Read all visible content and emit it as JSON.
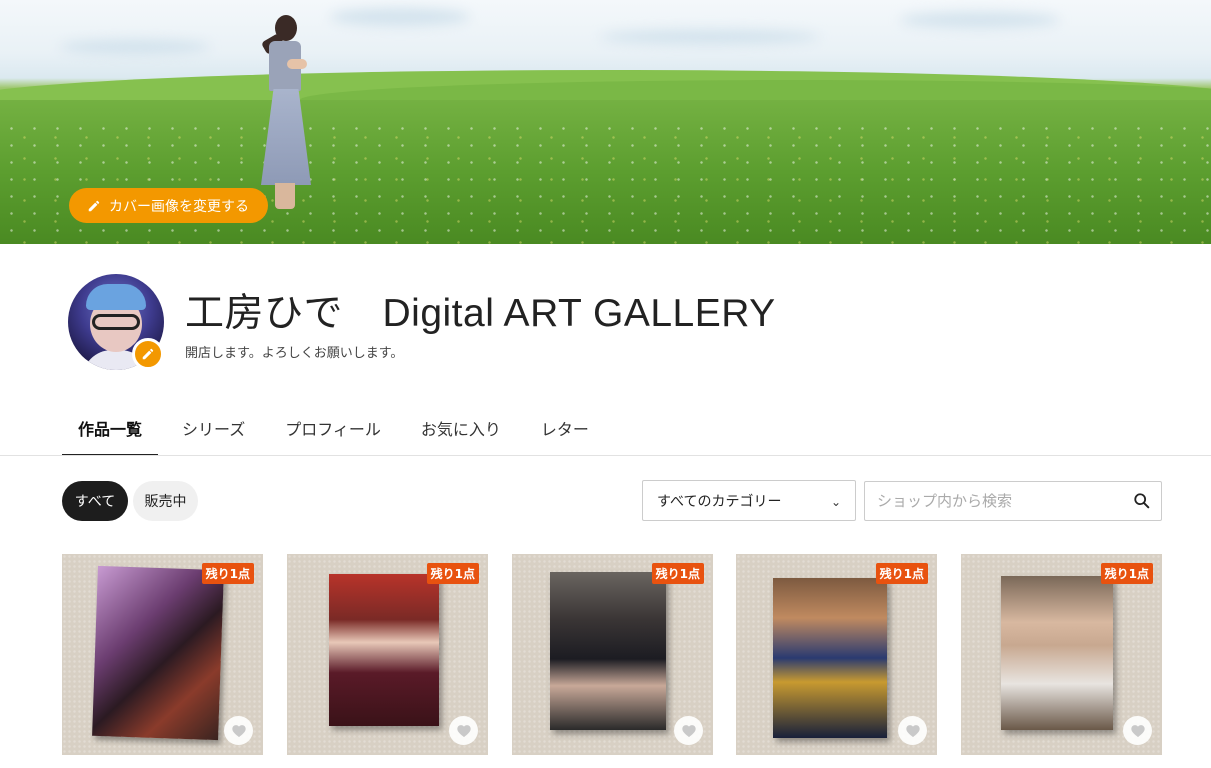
{
  "cover": {
    "change_button_label": "カバー画像を変更する"
  },
  "profile": {
    "shop_name": "工房ひで　Digital ART GALLERY",
    "description": "開店します。よろしくお願いします。"
  },
  "tabs": [
    {
      "label": "作品一覧",
      "active": true
    },
    {
      "label": "シリーズ",
      "active": false
    },
    {
      "label": "プロフィール",
      "active": false
    },
    {
      "label": "お気に入り",
      "active": false
    },
    {
      "label": "レター",
      "active": false
    }
  ],
  "filters": {
    "all_label": "すべて",
    "on_sale_label": "販売中",
    "category_selected": "すべてのカテゴリー",
    "search_placeholder": "ショップ内から検索"
  },
  "products": [
    {
      "badge": "残り1点",
      "icon": "heart-icon"
    },
    {
      "badge": "残り1点",
      "icon": "heart-icon"
    },
    {
      "badge": "残り1点",
      "icon": "heart-icon"
    },
    {
      "badge": "残り1点",
      "icon": "heart-icon"
    },
    {
      "badge": "残り1点",
      "icon": "heart-icon"
    }
  ],
  "colors": {
    "accent": "#f39800",
    "badge": "#e8520f",
    "chip_active": "#1d1d1d"
  }
}
